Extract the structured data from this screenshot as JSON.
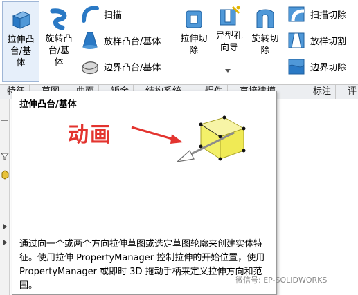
{
  "ribbon": {
    "extrude_boss": "拉伸凸\n台/基\n体",
    "revolve_boss": "旋转凸\n台/基\n体",
    "sweep": "扫描",
    "loft_boss": "放样凸台/基体",
    "boundary_boss": "边界凸台/基体",
    "extrude_cut": "拉伸切\n除",
    "hole_wizard": "异型孔\n向导",
    "revolve_cut": "旋转切\n除",
    "sweep_cut": "扫描切除",
    "loft_cut": "放样切割",
    "boundary_cut": "边界切除"
  },
  "tabs": [
    "特征",
    "草图",
    "曲面",
    "钣金",
    "结构系统",
    "焊件",
    "直接建模",
    "标注",
    "评"
  ],
  "tooltip": {
    "title": "拉伸凸台/基体",
    "animation_label": "动画",
    "description": "通过向一个或两个方向拉伸草图或选定草图轮廓来创建实体特征。使用拉伸 PropertyManager 控制拉伸的开始位置，使用 PropertyManager 或即时 3D 拖动手柄来定义拉伸方向和范围。"
  },
  "watermark": "微信号: EP-SOLIDWORKS",
  "colors": {
    "annotation_red": "#e3342f",
    "feature_yellow": "#f3f06a",
    "icon_blue": "#2a79c5"
  }
}
